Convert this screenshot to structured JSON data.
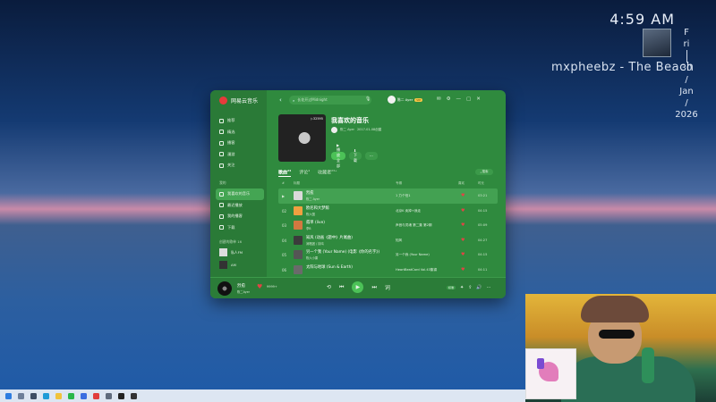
{
  "desktop": {
    "clock": "4:59 AM",
    "now_playing": "mxpheebz - The Beach",
    "date_chars": [
      "F",
      "ri",
      "30",
      "/",
      "Jan",
      "/",
      "2026"
    ]
  },
  "app": {
    "name": "网易云音乐",
    "search_placeholder": "长花开过Midnight",
    "user_name": "陈二 Ayer",
    "vip_badge": "VIP",
    "sidebar_main": [
      {
        "label": "推荐"
      },
      {
        "label": "精选"
      },
      {
        "label": "播客"
      },
      {
        "label": "漫游"
      },
      {
        "label": "关注"
      }
    ],
    "section_mine": "我的",
    "sidebar_mine": [
      {
        "label": "我喜欢的音乐",
        "active": true
      },
      {
        "label": "最近播放",
        "active": false
      },
      {
        "label": "我的播客",
        "active": false
      },
      {
        "label": "下载",
        "active": false
      }
    ],
    "section_playlists": "创建的歌单 16",
    "playlists": [
      {
        "label": "私人FM"
      },
      {
        "label": "AM"
      }
    ],
    "playlist": {
      "title": "我喜欢的音乐",
      "badge": "▷32595",
      "creator": "陈二 Ayer",
      "created": "2017-01-08创建",
      "play_label": "▶ 播放全部",
      "download_label": "⬇ 下载",
      "more_label": "···"
    },
    "tabs": [
      {
        "label": "歌曲",
        "count": "24",
        "active": true
      },
      {
        "label": "评论",
        "count": "4",
        "active": false
      },
      {
        "label": "收藏者",
        "count": "23+",
        "active": false
      }
    ],
    "search_in_label": "搜索",
    "table_headers": {
      "title": "标题",
      "album": "专辑",
      "like": "喜欢",
      "duration": "时长"
    },
    "songs": [
      {
        "idx": "▶",
        "title": "烈愈",
        "artist": "陈二 Ayer",
        "album": "1 力个怕1",
        "duration": "03:21",
        "color": "#dadada",
        "active": true
      },
      {
        "idx": "02",
        "title": "欧尼和大梦鲸",
        "artist": "陈六国",
        "album": "北京K 卖掉+我走",
        "duration": "04:15",
        "color": "#f0a040",
        "active": false
      },
      {
        "idx": "03",
        "title": "孤单 (live)",
        "artist": "李B",
        "album": "声音与灵魂 第二集 第2期",
        "duration": "05:09",
        "color": "#d27840",
        "active": false
      },
      {
        "idx": "04",
        "title": "知风 (动画《题中》片尾曲)",
        "artist": "润唱团 / 钟鸿",
        "album": "知风",
        "duration": "04:27",
        "color": "#3b3b3b",
        "active": false
      },
      {
        "idx": "05",
        "title": "另一个我 (Your Name) (电影《你的名字》)",
        "artist": "陈六小果",
        "album": "另一个我 (Your Name)",
        "duration": "04:15",
        "color": "#555555",
        "active": false
      },
      {
        "idx": "06",
        "title": "太阳与地球 (Sun & Earth)",
        "artist": "",
        "album": "HeartBeatCard Vol.43集锦",
        "duration": "04:11",
        "color": "#6a6a6a",
        "active": false
      }
    ],
    "player": {
      "title": "烈愈",
      "artist": "陈二Ayer",
      "count": "9999+",
      "quality": "标准"
    }
  },
  "colors": {
    "accent": "#4cc257",
    "heart": "#e04444",
    "app_bg": "#2f8a3e"
  },
  "taskbar_icons": [
    {
      "name": "windows-icon",
      "color": "#2e7de0"
    },
    {
      "name": "search-icon",
      "color": "#6d7f99"
    },
    {
      "name": "task-view-icon",
      "color": "#3e4d64"
    },
    {
      "name": "edge-icon",
      "color": "#1f9bd7"
    },
    {
      "name": "explorer-icon",
      "color": "#f0c33c"
    },
    {
      "name": "wechat-icon",
      "color": "#29b74a"
    },
    {
      "name": "store-icon",
      "color": "#3a6de0"
    },
    {
      "name": "netease-icon",
      "color": "#e13d3d"
    },
    {
      "name": "settings-icon",
      "color": "#5f6b7d"
    },
    {
      "name": "app-icon",
      "color": "#222222"
    },
    {
      "name": "app2-icon",
      "color": "#333333"
    }
  ]
}
